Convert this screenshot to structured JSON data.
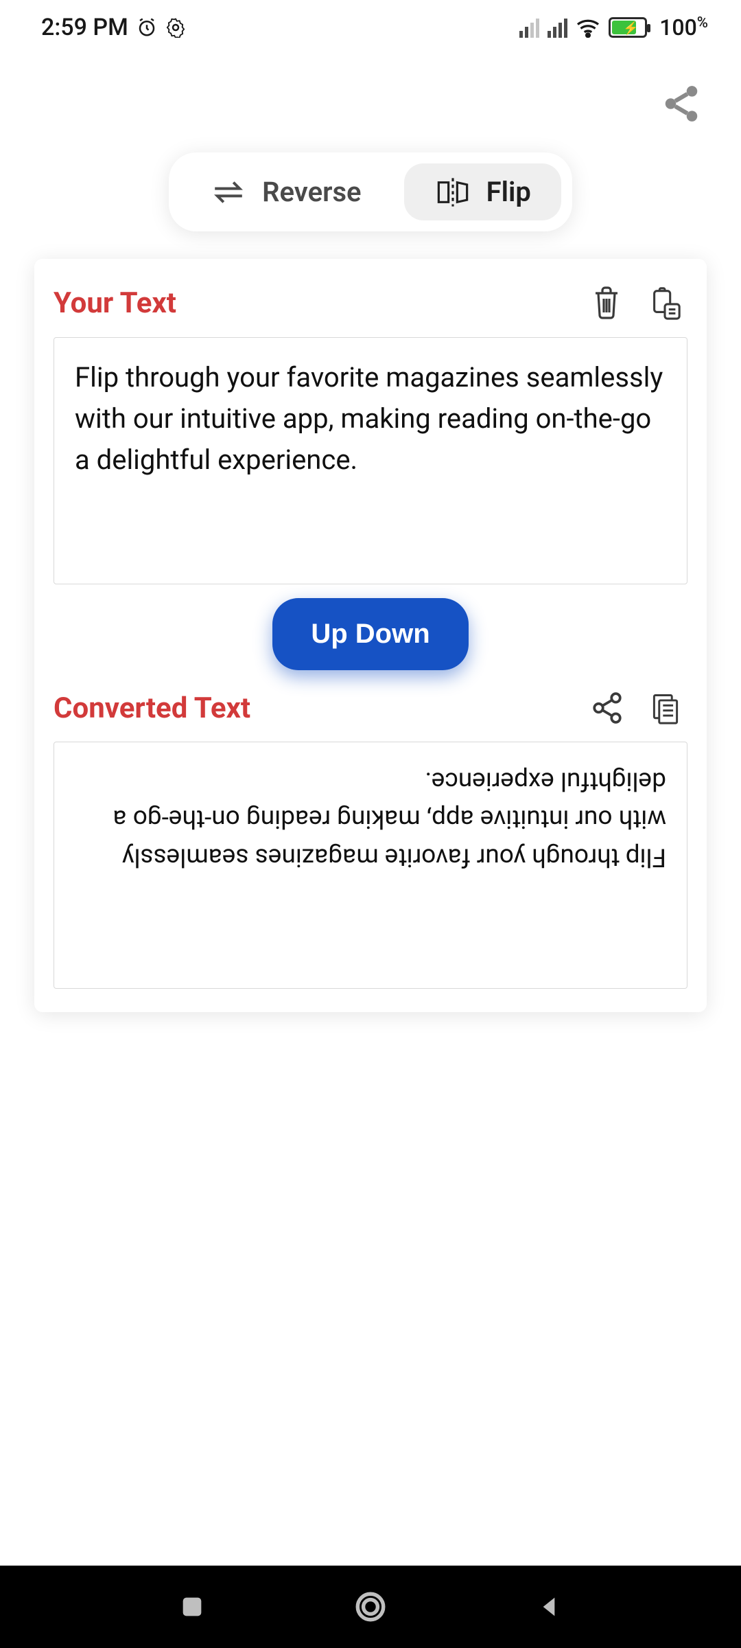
{
  "status": {
    "time": "2:59 PM",
    "battery_pct": "100",
    "battery_sym": "%"
  },
  "tabs": {
    "reverse_label": "Reverse",
    "flip_label": "Flip"
  },
  "input": {
    "title": "Your Text",
    "value": "Flip through your favorite magazines seamlessly with our intuitive app, making reading on-the-go a delightful experience."
  },
  "action": {
    "updown_label": "Up Down"
  },
  "output": {
    "title": "Converted Text",
    "value": "Flip through your favorite magazines seamlessly with our intuitive app, making reading on-the-go a delightful experience."
  }
}
